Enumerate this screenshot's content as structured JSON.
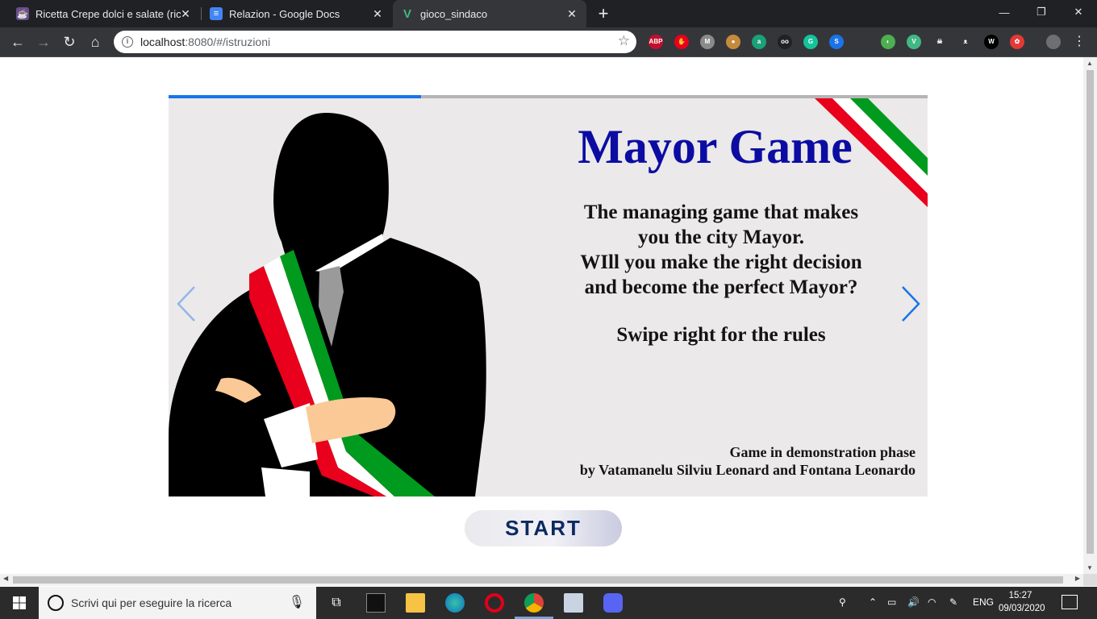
{
  "browser": {
    "tabs": [
      {
        "title": "Ricetta Crepe dolci e salate (ricett",
        "active": false
      },
      {
        "title": "Relazion - Google Docs",
        "active": false
      },
      {
        "title": "gioco_sindaco",
        "active": true
      }
    ],
    "new_tab_label": "+",
    "window_controls": {
      "minimize": "—",
      "restore": "❐",
      "close": "✕"
    },
    "url_host": "localhost",
    "url_rest": ":8080/#/istruzioni",
    "extensions": [
      {
        "name": "adblock-plus-icon",
        "label": "ABP",
        "color": "#c70d2c"
      },
      {
        "name": "stop-hand-icon",
        "label": "✋",
        "color": "#e8001c"
      },
      {
        "name": "m-icon",
        "label": "M",
        "color": "#8a8a8a"
      },
      {
        "name": "cookie-icon",
        "label": "●",
        "color": "#c58b3c"
      },
      {
        "name": "a-badge-icon",
        "label": "a",
        "color": "#1aa179"
      },
      {
        "name": "glasses-icon",
        "label": "oo",
        "color": "#202124"
      },
      {
        "name": "grammarly-icon",
        "label": "G",
        "color": "#15c39a"
      },
      {
        "name": "s-icon",
        "label": "S",
        "color": "#1a73e8"
      },
      {
        "name": "color-picker-icon",
        "label": "◐",
        "color": "#4caf50"
      },
      {
        "name": "vue-devtools-icon",
        "label": "V",
        "color": "#41b883"
      },
      {
        "name": "pirate-icon",
        "label": "☠",
        "color": "#35363a"
      },
      {
        "name": "cat-icon",
        "label": "ᴥ",
        "color": "#35363a"
      },
      {
        "name": "w-icon",
        "label": "W",
        "color": "#000000"
      },
      {
        "name": "palette-icon",
        "label": "✿",
        "color": "#e53935"
      }
    ]
  },
  "slide": {
    "title": "Mayor Game",
    "tagline_lines": [
      "The managing game that makes",
      "you the city Mayor.",
      "WIll you make the right decision",
      "and become the perfect Mayor?"
    ],
    "swipe_text": "Swipe right for the rules",
    "credits_line1": "Game in demonstration phase",
    "credits_line2": "by Vatamanelu Silviu Leonard and Fontana Leonardo",
    "progress_fraction": 0.333,
    "colors": {
      "title": "#0c0ca3",
      "progress": "#1a73e8",
      "arrow_left": "#93b6e8",
      "arrow_right": "#1a73e8"
    }
  },
  "start_button": {
    "label": "START",
    "text_color": "#0d2a62"
  },
  "taskbar": {
    "search_placeholder": "Scrivi qui per eseguire la ricerca",
    "language": "ENG",
    "time": "15:27",
    "date": "09/03/2020",
    "apps": [
      "task-view-icon",
      "terminal-icon",
      "file-explorer-icon",
      "edge-icon",
      "opera-icon",
      "chrome-icon",
      "photos-icon",
      "discord-icon"
    ]
  }
}
